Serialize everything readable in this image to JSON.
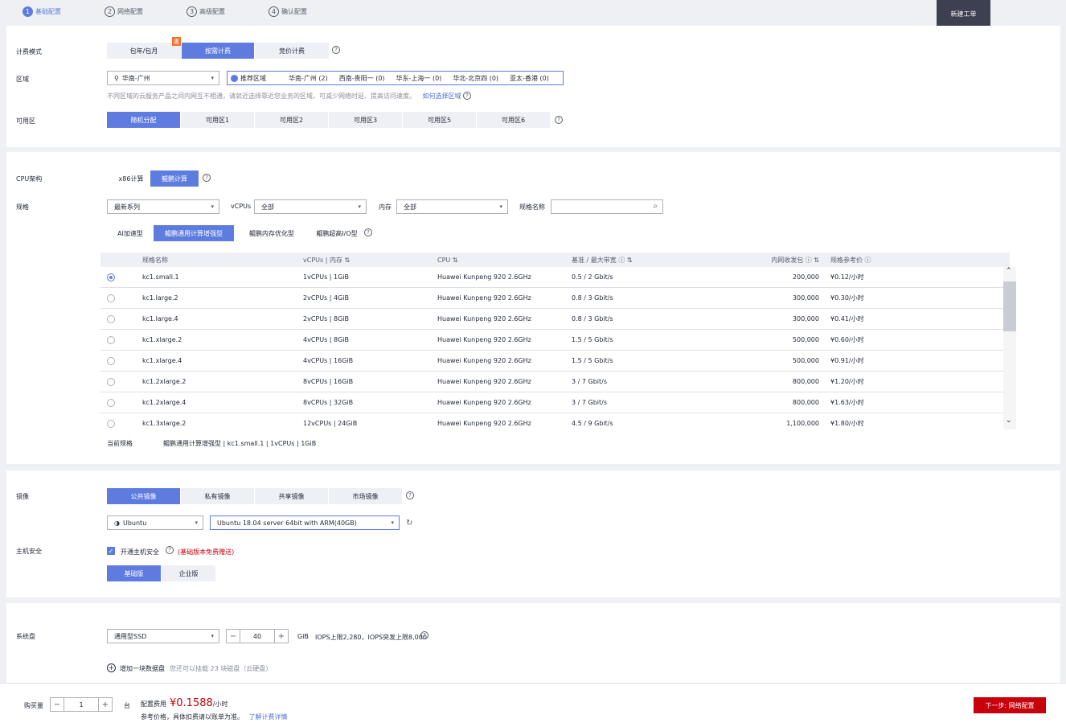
{
  "steps": [
    {
      "num": "1",
      "label": "基础配置"
    },
    {
      "num": "2",
      "label": "网络配置"
    },
    {
      "num": "3",
      "label": "高级配置"
    },
    {
      "num": "4",
      "label": "确认配置"
    }
  ],
  "ticket_label": "新建工单",
  "billing": {
    "label": "计费模式",
    "options": [
      "包年/包月",
      "按需计费",
      "竞价计费"
    ],
    "badge": "惠"
  },
  "region": {
    "label": "区域",
    "selected": "华南-广州",
    "quick": [
      "推荐区域",
      "华南-广州 (2)",
      "西南-贵阳一 (0)",
      "华东-上海一 (0)",
      "华北-北京四 (0)",
      "亚太-香港 (0)"
    ],
    "hint": "不同区域的云服务产品之间内网互不相通，请就近选择靠近您业务的区域，可减少网络时延、提高访问速度。",
    "hint_link": "如何选择区域"
  },
  "az": {
    "label": "可用区",
    "options": [
      "随机分配",
      "可用区1",
      "可用区2",
      "可用区3",
      "可用区5",
      "可用区6"
    ]
  },
  "cpu_arch": {
    "label": "CPU架构",
    "options": [
      "x86计算",
      "鲲鹏计算"
    ]
  },
  "spec": {
    "label": "规格",
    "series": "最新系列",
    "vcpus_label": "vCPUs",
    "vcpus_value": "全部",
    "mem_label": "内存",
    "mem_value": "全部",
    "name_label": "规格名称",
    "tabs": [
      "AI加速型",
      "鲲鹏通用计算增强型",
      "鲲鹏内存优化型",
      "鲲鹏超高I/O型"
    ]
  },
  "table": {
    "headers": [
      "规格名称",
      "vCPUs | 内存",
      "CPU",
      "基准 / 最大带宽",
      "内网收发包",
      "规格参考价"
    ],
    "rows": [
      {
        "name": "kc1.small.1",
        "cpu_mem": "1vCPUs | 1GiB",
        "cpu": "Huawei Kunpeng 920 2.6GHz",
        "bw": "0.5 / 2 Gbit/s",
        "pps": "200,000",
        "price": "¥0.12/小时"
      },
      {
        "name": "kc1.large.2",
        "cpu_mem": "2vCPUs | 4GiB",
        "cpu": "Huawei Kunpeng 920 2.6GHz",
        "bw": "0.8 / 3 Gbit/s",
        "pps": "300,000",
        "price": "¥0.30/小时"
      },
      {
        "name": "kc1.large.4",
        "cpu_mem": "2vCPUs | 8GiB",
        "cpu": "Huawei Kunpeng 920 2.6GHz",
        "bw": "0.8 / 3 Gbit/s",
        "pps": "300,000",
        "price": "¥0.41/小时"
      },
      {
        "name": "kc1.xlarge.2",
        "cpu_mem": "4vCPUs | 8GiB",
        "cpu": "Huawei Kunpeng 920 2.6GHz",
        "bw": "1.5 / 5 Gbit/s",
        "pps": "500,000",
        "price": "¥0.60/小时"
      },
      {
        "name": "kc1.xlarge.4",
        "cpu_mem": "4vCPUs | 16GiB",
        "cpu": "Huawei Kunpeng 920 2.6GHz",
        "bw": "1.5 / 5 Gbit/s",
        "pps": "500,000",
        "price": "¥0.91/小时"
      },
      {
        "name": "kc1.2xlarge.2",
        "cpu_mem": "8vCPUs | 16GiB",
        "cpu": "Huawei Kunpeng 920 2.6GHz",
        "bw": "3 / 7 Gbit/s",
        "pps": "800,000",
        "price": "¥1.20/小时"
      },
      {
        "name": "kc1.2xlarge.4",
        "cpu_mem": "8vCPUs | 32GiB",
        "cpu": "Huawei Kunpeng 920 2.6GHz",
        "bw": "3 / 7 Gbit/s",
        "pps": "800,000",
        "price": "¥1.63/小时"
      },
      {
        "name": "kc1.3xlarge.2",
        "cpu_mem": "12vCPUs | 24GiB",
        "cpu": "Huawei Kunpeng 920 2.6GHz",
        "bw": "4.5 / 9 Gbit/s",
        "pps": "1,100,000",
        "price": "¥1.80/小时"
      }
    ],
    "current_label": "当前规格",
    "current_value": "鲲鹏通用计算增强型 | kc1.small.1 | 1vCPUs | 1GiB"
  },
  "image": {
    "label": "镜像",
    "options": [
      "公共镜像",
      "私有镜像",
      "共享镜像",
      "市场镜像"
    ],
    "os": "Ubuntu",
    "version": "Ubuntu 18.04 server 64bit with ARM(40GB)"
  },
  "host_security": {
    "label": "主机安全",
    "check_label": "开通主机安全",
    "note": "(基础版本免费赠送)",
    "options": [
      "基础版",
      "企业版"
    ]
  },
  "system_disk": {
    "label": "系统盘",
    "type": "通用型SSD",
    "size": "40",
    "unit": "GiB",
    "iops": "IOPS上限2,280，IOPS突发上限8,000",
    "add_label": "增加一块数据盘",
    "add_hint": "您还可以挂载 23 块磁盘（云硬盘）"
  },
  "footer": {
    "qty_label": "购买量",
    "qty": "1",
    "qty_unit": "台",
    "fee_label": "配置费用",
    "price": "¥0.1588",
    "price_unit": "/小时",
    "note": "参考价格，具体扣费请以账单为准。",
    "note_link": "了解计费详情",
    "next": "下一步: 网络配置"
  }
}
